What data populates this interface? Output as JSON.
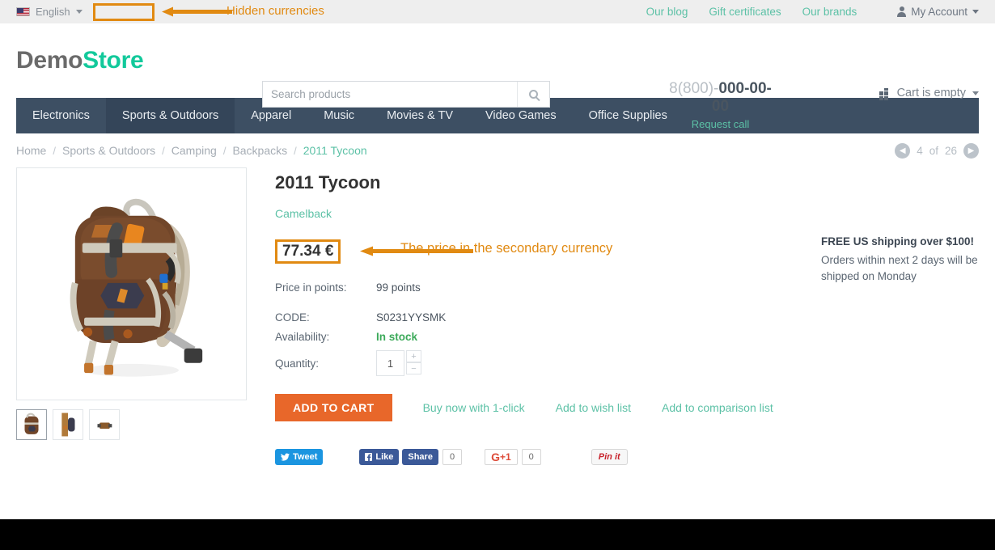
{
  "topbar": {
    "language": "English",
    "flag_icon": "us-flag-icon",
    "currency_box_value": "",
    "annotation": "Hidden currencies",
    "links": [
      "Our blog",
      "Gift certificates",
      "Our brands"
    ],
    "account": "My Account"
  },
  "header": {
    "logo_part1": "Demo",
    "logo_part2": "Store",
    "search_placeholder": "Search products",
    "search_value": "",
    "search_icon": "search-icon",
    "phone_prefix": "8(800)-",
    "phone_number": "000-00-00",
    "request_call": "Request call",
    "cart_label": "Cart is empty",
    "cart_icon": "cart-grid-icon"
  },
  "nav": {
    "items": [
      {
        "label": "Electronics",
        "active": false
      },
      {
        "label": "Sports & Outdoors",
        "active": true
      },
      {
        "label": "Apparel",
        "active": false
      },
      {
        "label": "Music",
        "active": false
      },
      {
        "label": "Movies & TV",
        "active": false
      },
      {
        "label": "Video Games",
        "active": false
      },
      {
        "label": "Office Supplies",
        "active": false
      }
    ]
  },
  "breadcrumb": {
    "items": [
      "Home",
      "Sports & Outdoors",
      "Camping",
      "Backpacks",
      "2011 Tycoon"
    ],
    "separator": "/"
  },
  "pager": {
    "prev_icon": "chevron-left-icon",
    "next_icon": "chevron-right-icon",
    "current": "4",
    "of_label": "of",
    "total": "26"
  },
  "product": {
    "title": "2011 Tycoon",
    "brand": "Camelback",
    "price": "77.34 €",
    "price_annotation": "The price in the secondary currency",
    "specs": [
      {
        "label": "Price in points:",
        "value": "99 points",
        "stock": false
      },
      {
        "label": "CODE:",
        "value": "S0231YYSMK",
        "stock": false
      },
      {
        "label": "Availability:",
        "value": "In stock",
        "stock": true
      }
    ],
    "quantity_label": "Quantity:",
    "quantity_value": "1",
    "qty_plus": "+",
    "qty_minus": "−",
    "image_alt": "brown-hydration-backpack",
    "thumbnails": [
      "backpack-front-thumb",
      "backpack-side-thumb",
      "backpack-detail-thumb"
    ]
  },
  "actions": {
    "add_to_cart": "ADD TO CART",
    "links": [
      "Buy now with 1-click",
      "Add to wish list",
      "Add to comparison list"
    ]
  },
  "social": {
    "twitter": "Tweet",
    "facebook_like": "Like",
    "facebook_share": "Share",
    "facebook_count": "0",
    "google_plus": "+1",
    "google_count": "0",
    "pinterest": "Pin it"
  },
  "shipping": {
    "title": "FREE US shipping over $100!",
    "body": "Orders within next 2 days will be shipped on Monday"
  },
  "colors": {
    "accent_orange": "#e8672a",
    "annotation_orange": "#e18a12",
    "teal": "#5cc1a6",
    "brand_green": "#12c99b",
    "nav_dark": "#3d4f63",
    "stock_green": "#3caa5a"
  }
}
